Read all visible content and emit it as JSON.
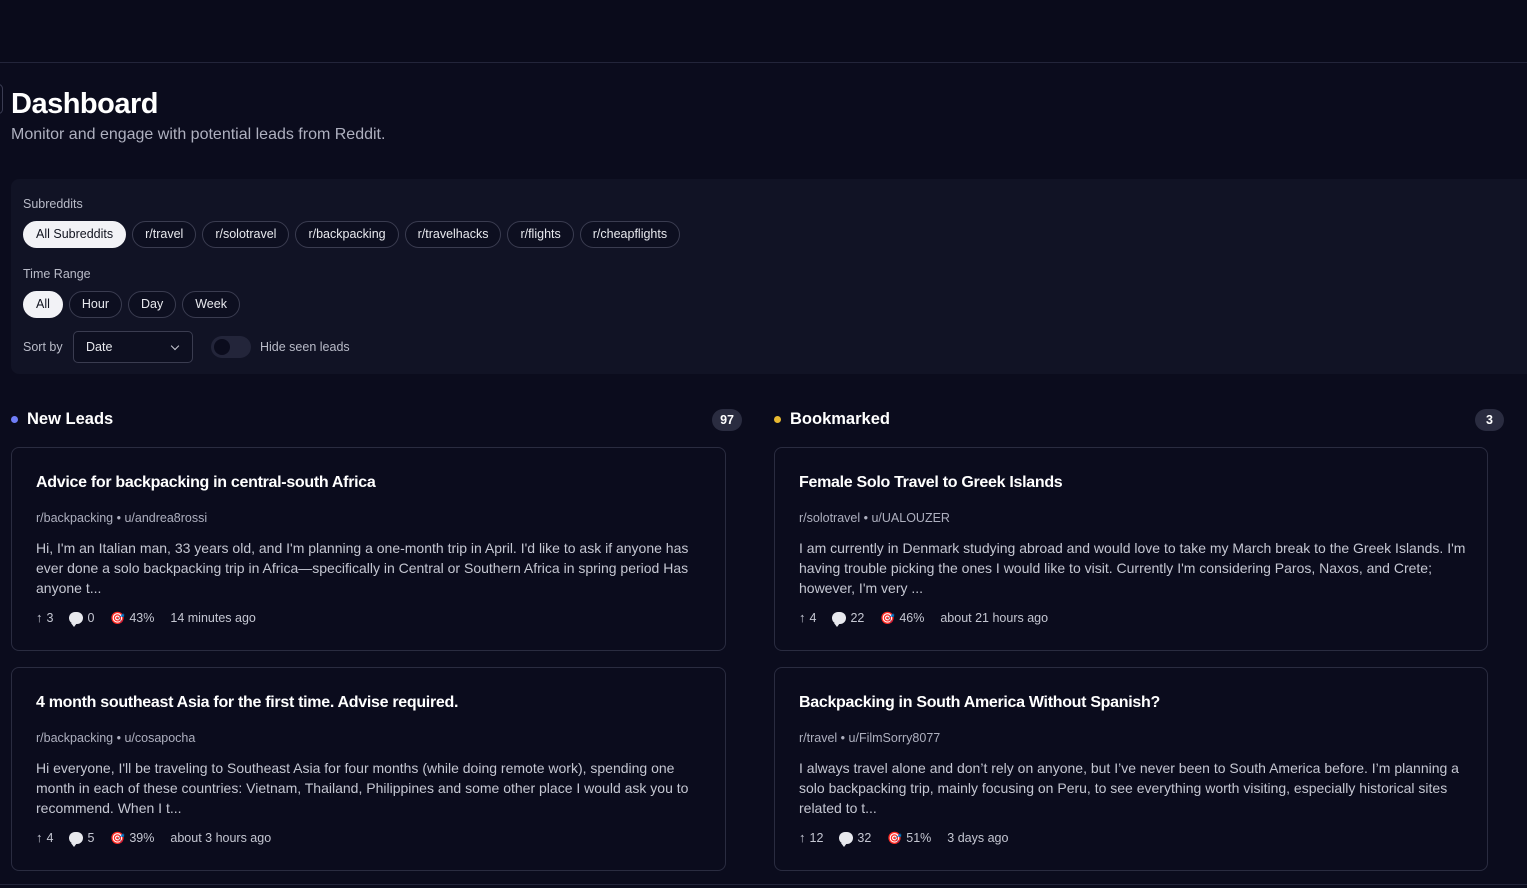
{
  "header": {
    "title": "Dashboard",
    "subtitle": "Monitor and engage with potential leads from Reddit."
  },
  "filters": {
    "subreddits_label": "Subreddits",
    "subreddits": [
      "All Subreddits",
      "r/travel",
      "r/solotravel",
      "r/backpacking",
      "r/travelhacks",
      "r/flights",
      "r/cheapflights"
    ],
    "subreddits_selected": "All Subreddits",
    "time_label": "Time Range",
    "time_ranges": [
      "All",
      "Hour",
      "Day",
      "Week"
    ],
    "time_selected": "All",
    "sort_label": "Sort by",
    "sort_value": "Date",
    "hide_seen_label": "Hide seen leads",
    "hide_seen_on": false
  },
  "columns": {
    "new_leads": {
      "title": "New Leads",
      "count": "97",
      "dot_color": "#6f7df7",
      "cards": [
        {
          "title": "Advice for backpacking in central-south Africa",
          "meta": "r/backpacking • u/andrea8rossi",
          "body": "Hi, I'm an Italian man, 33 years old, and I'm planning a one-month trip in April. I'd like to ask if anyone has ever done a solo backpacking trip in Africa—specifically in Central or Southern Africa in spring period Has anyone t...",
          "upvotes": "3",
          "comments": "0",
          "score": "43%",
          "time": "14 minutes ago"
        },
        {
          "title": "4 month southeast Asia for the first time. Advise required.",
          "meta": "r/backpacking • u/cosapocha",
          "body": "Hi everyone, I'll be traveling to Southeast Asia for four months (while doing remote work), spending one month in each of these countries: Vietnam, Thailand, Philippines and some other place I would ask you to recommend. When I t...",
          "upvotes": "4",
          "comments": "5",
          "score": "39%",
          "time": "about 3 hours ago"
        }
      ]
    },
    "bookmarked": {
      "title": "Bookmarked",
      "count": "3",
      "dot_color": "#e8b931",
      "cards": [
        {
          "title": "Female Solo Travel to Greek Islands",
          "meta": "r/solotravel • u/UALOUZER",
          "body": "I am currently in Denmark studying abroad and would love to take my March break to the Greek Islands. I'm having trouble picking the ones I would like to visit. Currently I'm considering Paros, Naxos, and Crete; however, I'm very ...",
          "upvotes": "4",
          "comments": "22",
          "score": "46%",
          "time": "about 21 hours ago"
        },
        {
          "title": "Backpacking in South America Without Spanish?",
          "meta": "r/travel • u/FilmSorry8077",
          "body": "I always travel alone and don’t rely on anyone, but I’ve never been to South America before. I’m planning a solo backpacking trip, mainly focusing on Peru, to see everything worth visiting, especially historical sites related to t...",
          "upvotes": "12",
          "comments": "32",
          "score": "51%",
          "time": "3 days ago"
        }
      ]
    }
  },
  "icons": {
    "upvote": "arrow-up-icon",
    "comments": "comment-bubble-icon",
    "score": "target-icon"
  }
}
